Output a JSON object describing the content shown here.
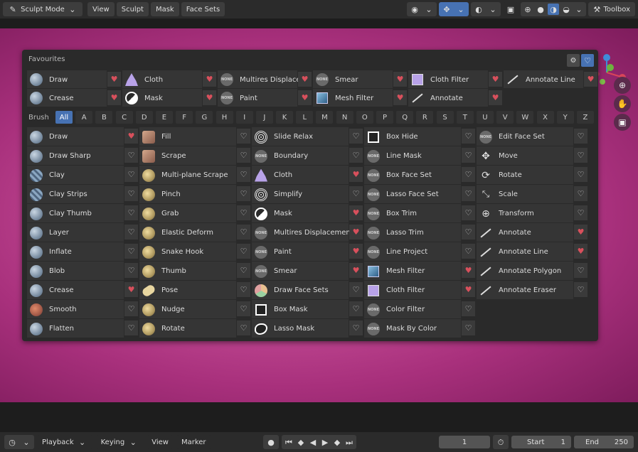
{
  "header": {
    "mode": "Sculpt Mode",
    "menus": [
      "View",
      "Sculpt",
      "Mask",
      "Face Sets"
    ],
    "toolbox": "Toolbox"
  },
  "favourites": {
    "title": "Favourites",
    "items": [
      {
        "label": "Draw",
        "icon": "draw",
        "fav": true
      },
      {
        "label": "Cloth",
        "icon": "cloth",
        "fav": true
      },
      {
        "label": "Multires Displacement Era...",
        "icon": "none",
        "fav": true
      },
      {
        "label": "Smear",
        "icon": "none",
        "fav": true
      },
      {
        "label": "Cloth Filter",
        "icon": "clothfilter",
        "fav": true
      },
      {
        "label": "Annotate Line",
        "icon": "annotate",
        "fav": true
      },
      {
        "label": "Crease",
        "icon": "crease",
        "fav": true
      },
      {
        "label": "Mask",
        "icon": "mask",
        "fav": true
      },
      {
        "label": "Paint",
        "icon": "none",
        "fav": true
      },
      {
        "label": "Mesh Filter",
        "icon": "meshfilter",
        "fav": true
      },
      {
        "label": "Annotate",
        "icon": "annotate",
        "fav": true
      }
    ]
  },
  "brush_label": "Brush",
  "alphabet": [
    "All",
    "A",
    "B",
    "C",
    "D",
    "E",
    "F",
    "G",
    "H",
    "I",
    "J",
    "K",
    "L",
    "M",
    "N",
    "O",
    "P",
    "Q",
    "R",
    "S",
    "T",
    "U",
    "V",
    "W",
    "X",
    "Y",
    "Z"
  ],
  "brushes": [
    [
      {
        "label": "Draw",
        "icon": "draw",
        "fav": true
      },
      {
        "label": "Draw Sharp",
        "icon": "sphere",
        "fav": false
      },
      {
        "label": "Clay",
        "icon": "clay",
        "fav": false
      },
      {
        "label": "Clay Strips",
        "icon": "clay",
        "fav": false
      },
      {
        "label": "Clay Thumb",
        "icon": "sphere",
        "fav": false
      },
      {
        "label": "Layer",
        "icon": "sphere",
        "fav": false
      },
      {
        "label": "Inflate",
        "icon": "sphere",
        "fav": false
      },
      {
        "label": "Blob",
        "icon": "sphere",
        "fav": false
      },
      {
        "label": "Crease",
        "icon": "crease",
        "fav": true
      },
      {
        "label": "Smooth",
        "icon": "smooth",
        "fav": false
      },
      {
        "label": "Flatten",
        "icon": "sphere",
        "fav": false
      }
    ],
    [
      {
        "label": "Fill",
        "icon": "fill",
        "fav": false
      },
      {
        "label": "Scrape",
        "icon": "fill",
        "fav": false
      },
      {
        "label": "Multi-plane Scrape",
        "icon": "grab",
        "fav": false
      },
      {
        "label": "Pinch",
        "icon": "grab",
        "fav": false
      },
      {
        "label": "Grab",
        "icon": "grab",
        "fav": false
      },
      {
        "label": "Elastic Deform",
        "icon": "grab",
        "fav": false
      },
      {
        "label": "Snake Hook",
        "icon": "grab",
        "fav": false
      },
      {
        "label": "Thumb",
        "icon": "grab",
        "fav": false
      },
      {
        "label": "Pose",
        "icon": "pose",
        "fav": false
      },
      {
        "label": "Nudge",
        "icon": "grab",
        "fav": false
      },
      {
        "label": "Rotate",
        "icon": "grab",
        "fav": false
      }
    ],
    [
      {
        "label": "Slide Relax",
        "icon": "relax",
        "fav": false
      },
      {
        "label": "Boundary",
        "icon": "none",
        "fav": false
      },
      {
        "label": "Cloth",
        "icon": "cloth",
        "fav": true
      },
      {
        "label": "Simplify",
        "icon": "relax",
        "fav": false
      },
      {
        "label": "Mask",
        "icon": "mask",
        "fav": true
      },
      {
        "label": "Multires Displacement...",
        "icon": "none",
        "fav": true
      },
      {
        "label": "Paint",
        "icon": "none",
        "fav": true
      },
      {
        "label": "Smear",
        "icon": "none",
        "fav": true
      },
      {
        "label": "Draw Face Sets",
        "icon": "facesets",
        "fav": false
      },
      {
        "label": "Box Mask",
        "icon": "boxmask",
        "fav": false
      },
      {
        "label": "Lasso Mask",
        "icon": "lassomask",
        "fav": false
      }
    ],
    [
      {
        "label": "Box Hide",
        "icon": "boxhide",
        "fav": false
      },
      {
        "label": "Line Mask",
        "icon": "none",
        "fav": false
      },
      {
        "label": "Box Face Set",
        "icon": "none",
        "fav": false
      },
      {
        "label": "Lasso Face Set",
        "icon": "none",
        "fav": false
      },
      {
        "label": "Box Trim",
        "icon": "none",
        "fav": false
      },
      {
        "label": "Lasso Trim",
        "icon": "none",
        "fav": false
      },
      {
        "label": "Line Project",
        "icon": "none",
        "fav": false
      },
      {
        "label": "Mesh Filter",
        "icon": "meshfilter",
        "fav": true
      },
      {
        "label": "Cloth Filter",
        "icon": "clothfilter",
        "fav": true
      },
      {
        "label": "Color Filter",
        "icon": "none",
        "fav": false
      },
      {
        "label": "Mask By Color",
        "icon": "none",
        "fav": false
      }
    ],
    [
      {
        "label": "Edit Face Set",
        "icon": "none",
        "fav": false
      },
      {
        "label": "Move",
        "icon": "move",
        "fav": false
      },
      {
        "label": "Rotate",
        "icon": "rotate",
        "fav": false
      },
      {
        "label": "Scale",
        "icon": "scale",
        "fav": false
      },
      {
        "label": "Transform",
        "icon": "transform",
        "fav": false
      },
      {
        "label": "Annotate",
        "icon": "annotate",
        "fav": true
      },
      {
        "label": "Annotate Line",
        "icon": "annotate",
        "fav": true
      },
      {
        "label": "Annotate Polygon",
        "icon": "annotate",
        "fav": false
      },
      {
        "label": "Annotate Eraser",
        "icon": "annotate",
        "fav": false
      }
    ]
  ],
  "timeline": {
    "playback": "Playback",
    "keying": "Keying",
    "view": "View",
    "marker": "Marker",
    "current_frame": "1",
    "start_label": "Start",
    "start": "1",
    "end_label": "End",
    "end": "250"
  }
}
